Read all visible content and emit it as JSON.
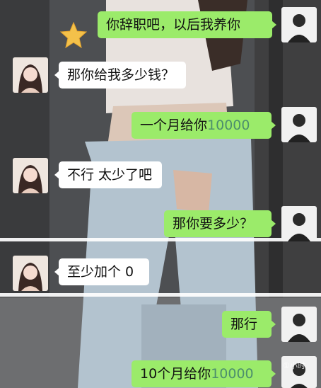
{
  "messages": [
    {
      "side": "me",
      "text_before": "你辞职吧，以后我养你",
      "number": "",
      "text_after": ""
    },
    {
      "side": "her",
      "text_before": "那你给我多少钱？",
      "number": "",
      "text_after": ""
    },
    {
      "side": "me",
      "text_before": "一个月给你",
      "number": "10000",
      "text_after": ""
    },
    {
      "side": "her",
      "text_before": "不行 太少了吧",
      "number": "",
      "text_after": ""
    },
    {
      "side": "me",
      "text_before": "那你要多少？",
      "number": "",
      "text_after": ""
    },
    {
      "side": "her",
      "text_before": "至少加个 0",
      "number": "",
      "text_after": ""
    },
    {
      "side": "me",
      "text_before": "那行",
      "number": "",
      "text_after": ""
    },
    {
      "side": "me",
      "text_before": "10个月给你",
      "number": "10000",
      "text_after": ""
    }
  ],
  "watermark": "①小时",
  "colors": {
    "my_bubble": "#9beb6a",
    "her_bubble": "#ffffff",
    "number_text": "#4c8f6c"
  },
  "icons": {
    "decoration": "star-icon",
    "my_avatar": "man-avatar",
    "her_avatar": "woman-avatar"
  }
}
